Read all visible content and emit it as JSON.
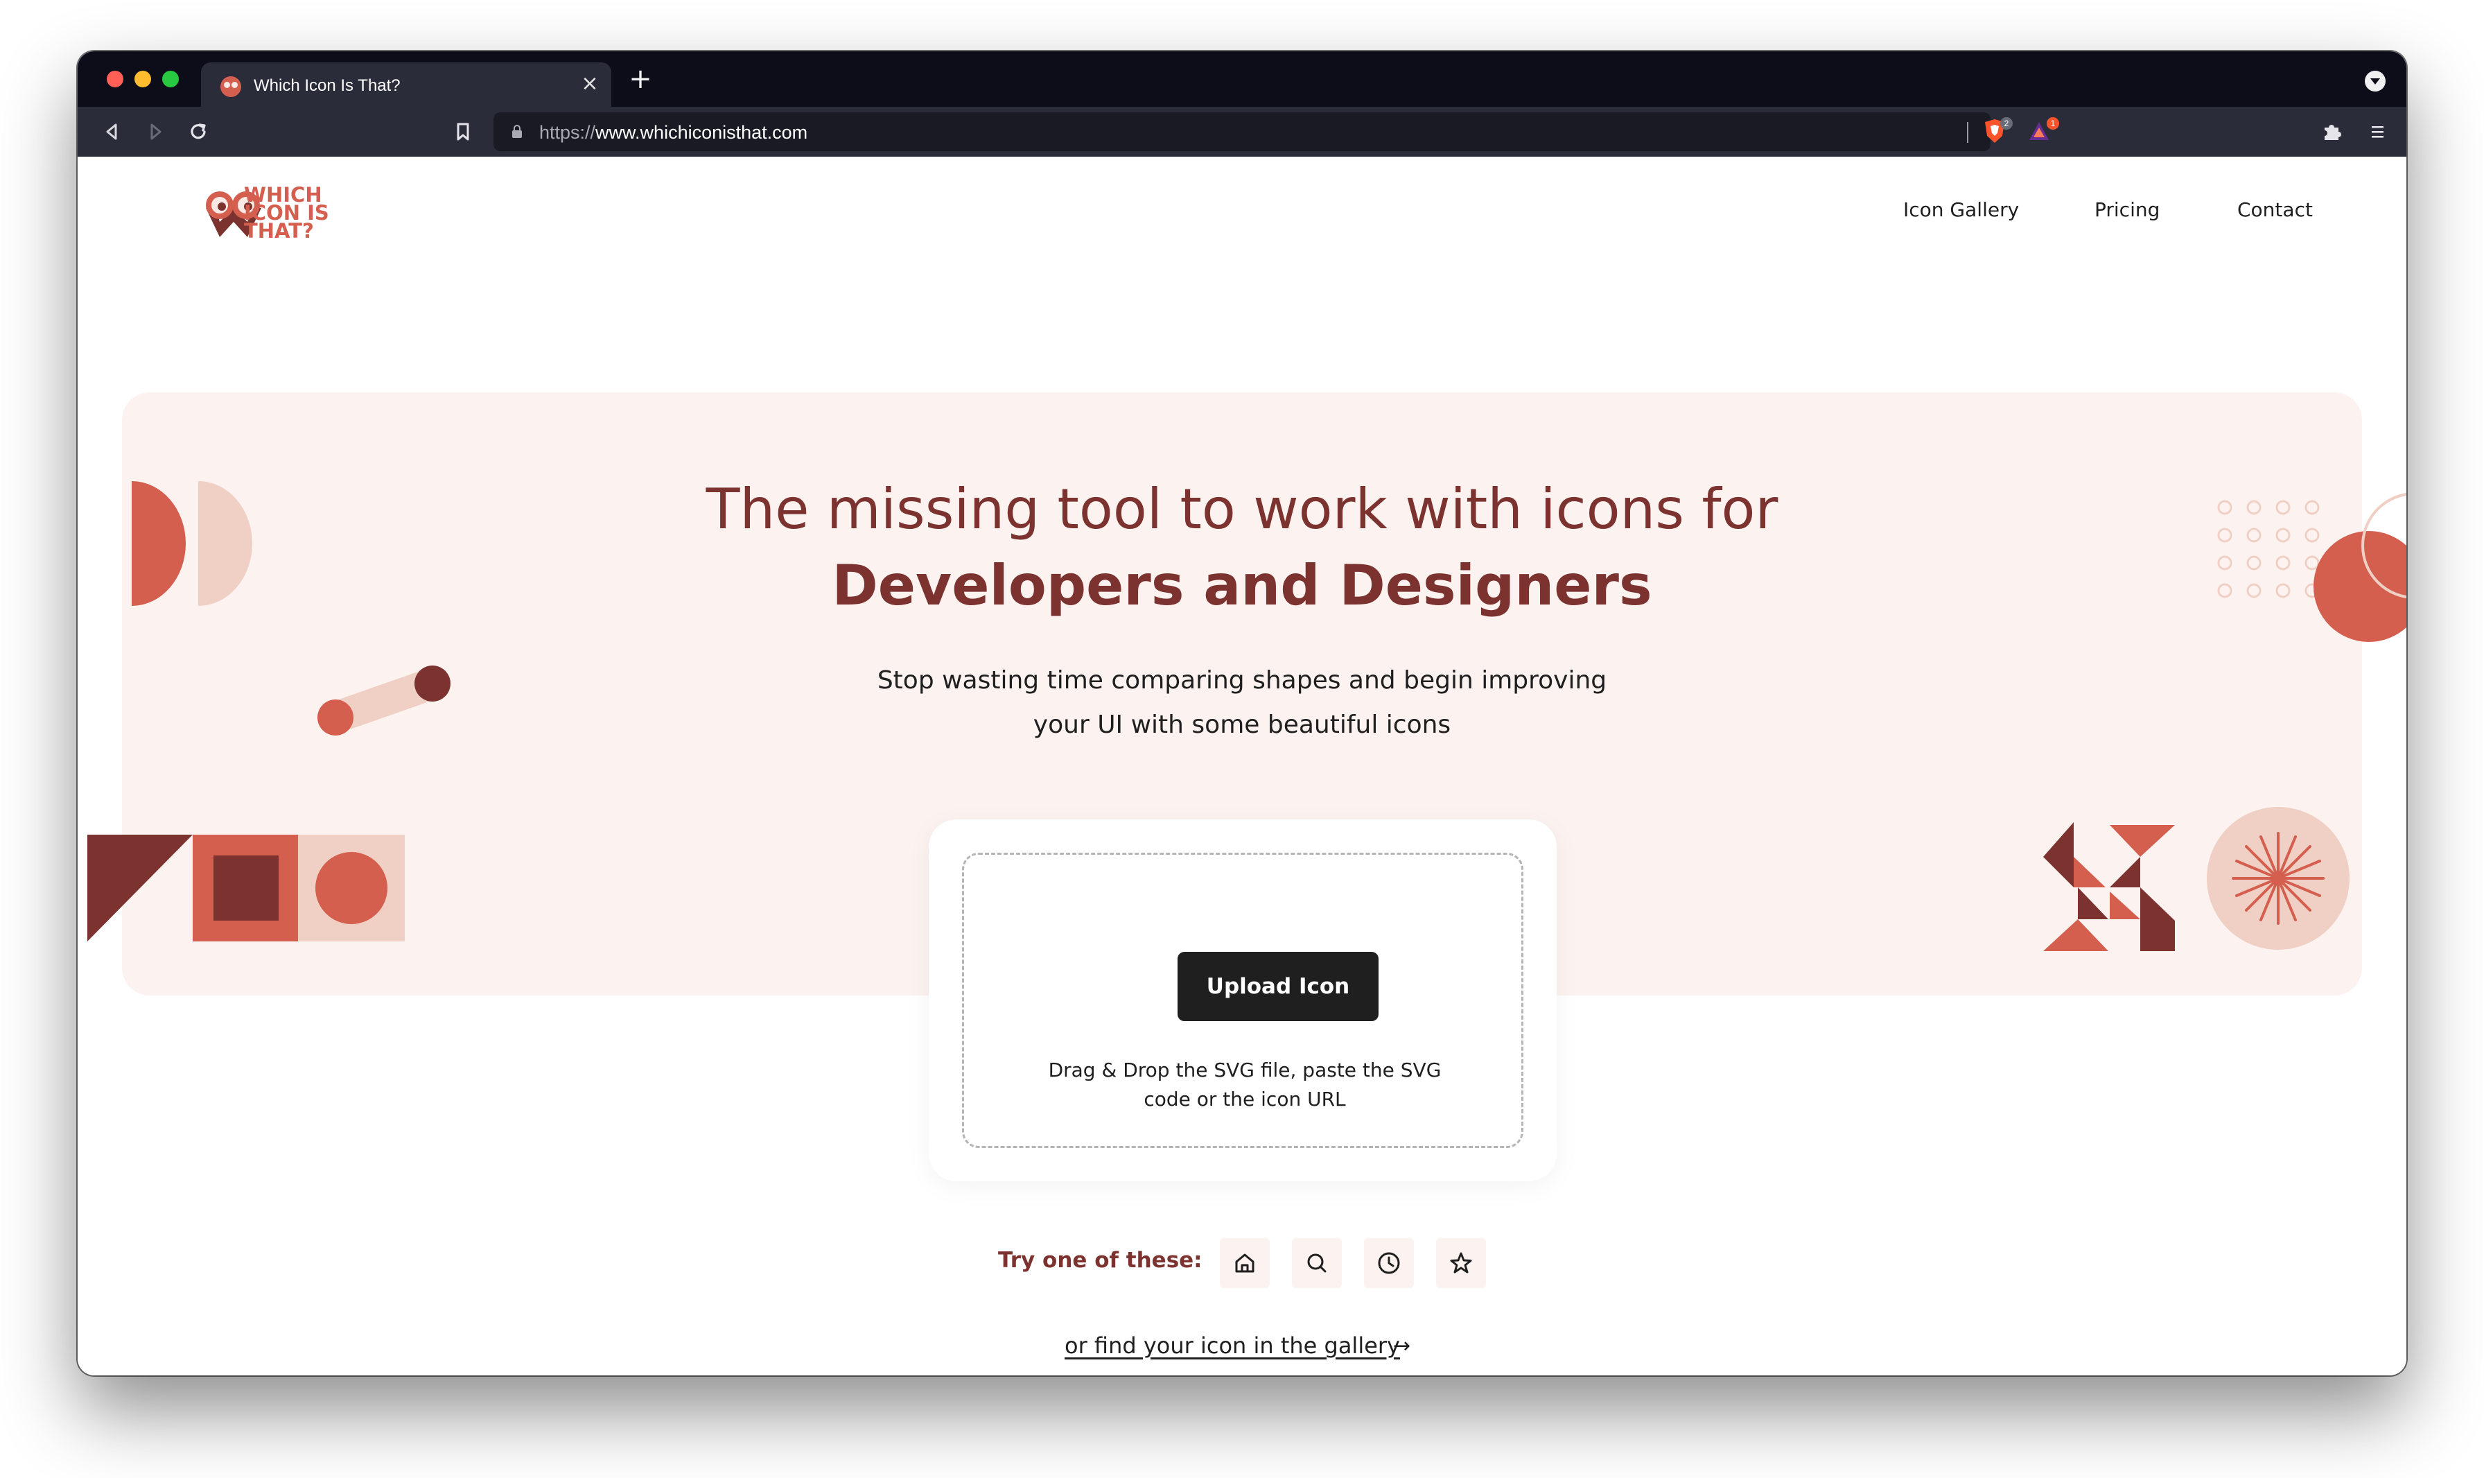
{
  "browser": {
    "tab_title": "Which Icon Is That?",
    "tab_close": "×",
    "new_tab": "+",
    "url_scheme": "https://",
    "url_host": "www.whichiconisthat.com",
    "brave_badge": "2",
    "rewards_badge": "1"
  },
  "site": {
    "logo_lines": [
      "WHICH",
      "ICON IS",
      "THAT?"
    ],
    "nav": [
      "Icon Gallery",
      "Pricing",
      "Contact"
    ]
  },
  "hero": {
    "title_line1": "The missing tool to work with icons for",
    "title_line2": "Developers and Designers",
    "subtitle_line1": "Stop wasting time comparing shapes and begin improving",
    "subtitle_line2": "your UI with some beautiful icons"
  },
  "upload": {
    "button_label": "Upload Icon",
    "hint_line1": "Drag & Drop the SVG file, paste the SVG",
    "hint_line2": "code or the icon URL"
  },
  "try": {
    "label": "Try one of these:",
    "icons": [
      "home-icon",
      "search-icon",
      "clock-icon",
      "star-icon"
    ]
  },
  "gallery_link": {
    "label": "or find your icon in the gallery",
    "arrow": "→"
  },
  "colors": {
    "brand_dark": "#7c3330",
    "brand_accent": "#d45f4f",
    "brand_light": "#f0d0c4",
    "hero_bg": "#fcf2ef"
  }
}
